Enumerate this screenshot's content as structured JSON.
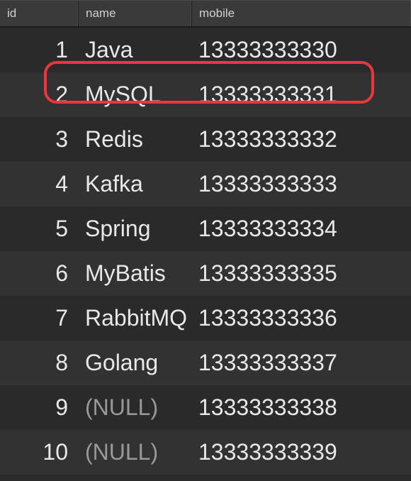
{
  "headers": {
    "id": "id",
    "name": "name",
    "mobile": "mobile"
  },
  "rows": [
    {
      "id": "1",
      "name": "Java",
      "mobile": "13333333330",
      "highlighted": true
    },
    {
      "id": "2",
      "name": "MySQL",
      "mobile": "13333333331"
    },
    {
      "id": "3",
      "name": "Redis",
      "mobile": "13333333332"
    },
    {
      "id": "4",
      "name": "Kafka",
      "mobile": "13333333333"
    },
    {
      "id": "5",
      "name": "Spring",
      "mobile": "13333333334"
    },
    {
      "id": "6",
      "name": "MyBatis",
      "mobile": "13333333335"
    },
    {
      "id": "7",
      "name": "RabbitMQ",
      "mobile": "13333333336"
    },
    {
      "id": "8",
      "name": "Golang",
      "mobile": "13333333337"
    },
    {
      "id": "9",
      "name": "(NULL)",
      "mobile": "13333333338",
      "isNull": true
    },
    {
      "id": "10",
      "name": "(NULL)",
      "mobile": "13333333339",
      "isNull": true
    }
  ]
}
